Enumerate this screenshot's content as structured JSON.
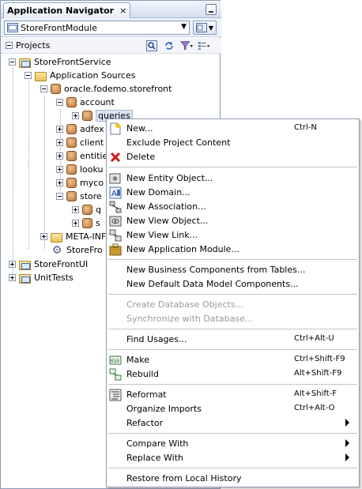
{
  "window": {
    "title": "Application Navigator",
    "close_glyph": "×"
  },
  "module": {
    "selected": "StoreFrontModule"
  },
  "projects": {
    "label": "Projects"
  },
  "tree": [
    {
      "label": "StoreFrontService",
      "icon": "project-icon",
      "toggle": "minus"
    },
    {
      "label": "Application Sources",
      "icon": "folder-icon",
      "toggle": "minus"
    },
    {
      "label": "oracle.fodemo.storefront",
      "icon": "package-icon",
      "toggle": "minus"
    },
    {
      "label": "account",
      "icon": "package-icon",
      "toggle": "minus"
    },
    {
      "label": "queries",
      "icon": "package-icon",
      "toggle": "plus"
    },
    {
      "label": "adfex",
      "icon": "package-icon",
      "toggle": "plus"
    },
    {
      "label": "client",
      "icon": "package-icon",
      "toggle": "plus"
    },
    {
      "label": "entitie",
      "icon": "package-icon",
      "toggle": "plus"
    },
    {
      "label": "looku",
      "icon": "package-icon",
      "toggle": "plus"
    },
    {
      "label": "myco",
      "icon": "package-icon",
      "toggle": "plus"
    },
    {
      "label": "store",
      "icon": "package-icon",
      "toggle": "minus"
    },
    {
      "label": "q",
      "icon": "package-icon",
      "toggle": "plus"
    },
    {
      "label": "s",
      "icon": "package-icon",
      "toggle": "plus"
    },
    {
      "label": "META-INF",
      "icon": "folder-icon",
      "toggle": "plus"
    },
    {
      "label": "StoreFro",
      "icon": "gear-icon",
      "toggle": "none"
    },
    {
      "label": "StoreFrontUI",
      "icon": "project-icon",
      "toggle": "plus"
    },
    {
      "label": "UnitTests",
      "icon": "project-icon",
      "toggle": "plus"
    }
  ],
  "context_menu": {
    "items": [
      {
        "label": "New...",
        "accel": "Ctrl-N",
        "icon": "new-icon"
      },
      {
        "label": "Exclude Project Content"
      },
      {
        "label": "Delete",
        "icon": "delete-icon"
      },
      {
        "label": "New Entity Object...",
        "icon": "entity-object-icon"
      },
      {
        "label": "New Domain...",
        "icon": "domain-icon"
      },
      {
        "label": "New Association...",
        "icon": "association-icon"
      },
      {
        "label": "New View Object...",
        "icon": "view-object-icon"
      },
      {
        "label": "New View Link...",
        "icon": "view-link-icon"
      },
      {
        "label": "New Application Module...",
        "icon": "application-module-icon"
      },
      {
        "label": "New Business Components from Tables..."
      },
      {
        "label": "New Default Data Model Components..."
      },
      {
        "label": "Create Database Objects...",
        "disabled": true
      },
      {
        "label": "Synchronize with Database...",
        "disabled": true
      },
      {
        "label": "Find Usages...",
        "accel": "Ctrl+Alt-U"
      },
      {
        "label": "Make",
        "accel": "Ctrl+Shift-F9",
        "icon": "make-icon"
      },
      {
        "label": "Rebuild",
        "accel": "Alt+Shift-F9",
        "icon": "rebuild-icon"
      },
      {
        "label": "Reformat",
        "accel": "Alt+Shift-F",
        "icon": "reformat-icon"
      },
      {
        "label": "Organize Imports",
        "accel": "Ctrl+Alt-O"
      },
      {
        "label": "Refactor",
        "submenu": true
      },
      {
        "label": "Compare With",
        "submenu": true
      },
      {
        "label": "Replace With",
        "submenu": true
      },
      {
        "label": "Restore from Local History"
      }
    ]
  },
  "colors": {
    "menu_border": "#8f9bb0",
    "selection": "#dbe4f3",
    "disabled_text": "#9a9a9a"
  }
}
